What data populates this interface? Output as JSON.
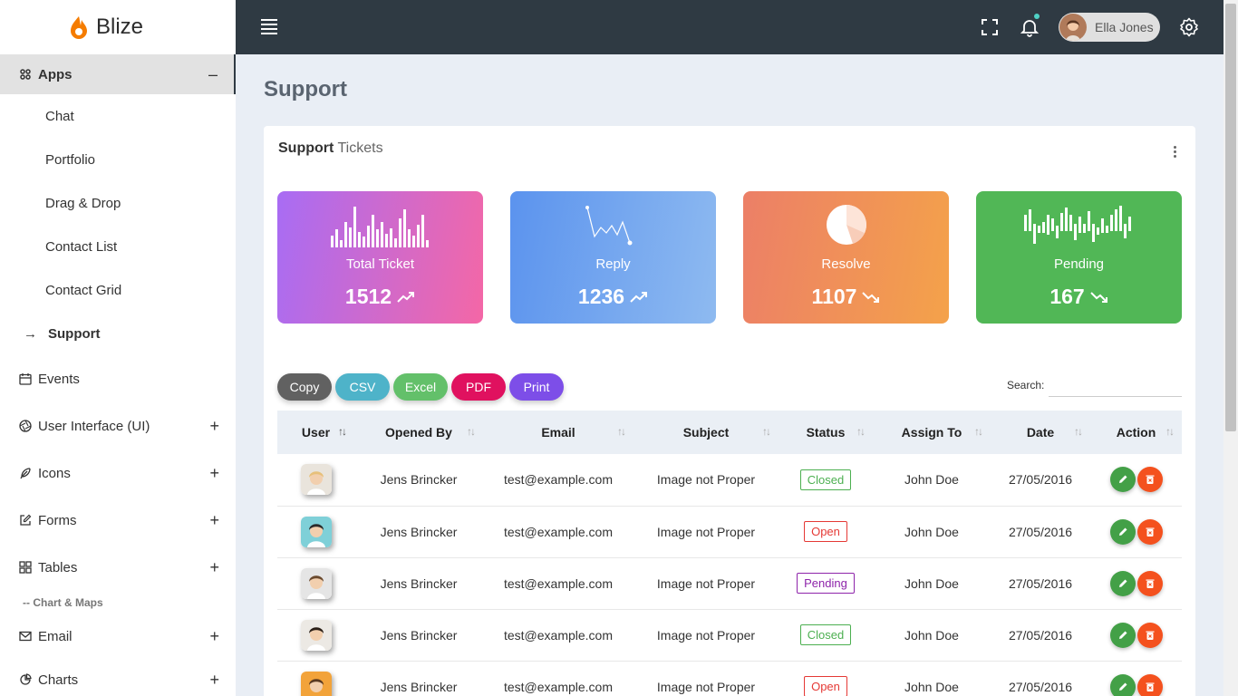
{
  "brand": {
    "name": "Blize"
  },
  "sidebar": {
    "apps": {
      "label": "Apps",
      "toggle": "–"
    },
    "app_items": [
      "Chat",
      "Portfolio",
      "Drag & Drop",
      "Contact List",
      "Contact Grid"
    ],
    "current_item": {
      "arrow": "→",
      "label": "Support"
    },
    "items": [
      {
        "label": "Events",
        "toggle": ""
      },
      {
        "label": "User Interface (UI)",
        "toggle": "+"
      },
      {
        "label": "Icons",
        "toggle": "+"
      },
      {
        "label": "Forms",
        "toggle": "+"
      },
      {
        "label": "Tables",
        "toggle": "+"
      }
    ],
    "section": "-- Chart & Maps",
    "items2": [
      {
        "label": "Email",
        "toggle": "+"
      },
      {
        "label": "Charts",
        "toggle": "+"
      }
    ]
  },
  "topbar": {
    "user_name": "Ella Jones"
  },
  "page": {
    "title": "Support"
  },
  "card": {
    "title_bold": "Support",
    "title_light": " Tickets"
  },
  "stats": [
    {
      "label": "Total Ticket",
      "value": "1512",
      "trend": "up"
    },
    {
      "label": "Reply",
      "value": "1236",
      "trend": "up"
    },
    {
      "label": "Resolve",
      "value": "1107",
      "trend": "down"
    },
    {
      "label": "Pending",
      "value": "167",
      "trend": "down"
    }
  ],
  "export_buttons": [
    {
      "label": "Copy",
      "color": "#616161"
    },
    {
      "label": "CSV",
      "color": "#4eb3c9"
    },
    {
      "label": "Excel",
      "color": "#63c06a"
    },
    {
      "label": "PDF",
      "color": "#e0115f"
    },
    {
      "label": "Print",
      "color": "#7d4ee8"
    }
  ],
  "search": {
    "label": "Search:",
    "value": ""
  },
  "table": {
    "headers": [
      "User",
      "Opened By",
      "Email",
      "Subject",
      "Status",
      "Assign To",
      "Date",
      "Action"
    ],
    "rows": [
      {
        "opened_by": "Jens Brincker",
        "email": "test@example.com",
        "subject": "Image not Proper",
        "status": "Closed",
        "assign_to": "John Doe",
        "date": "27/05/2016"
      },
      {
        "opened_by": "Jens Brincker",
        "email": "test@example.com",
        "subject": "Image not Proper",
        "status": "Open",
        "assign_to": "John Doe",
        "date": "27/05/2016"
      },
      {
        "opened_by": "Jens Brincker",
        "email": "test@example.com",
        "subject": "Image not Proper",
        "status": "Pending",
        "assign_to": "John Doe",
        "date": "27/05/2016"
      },
      {
        "opened_by": "Jens Brincker",
        "email": "test@example.com",
        "subject": "Image not Proper",
        "status": "Closed",
        "assign_to": "John Doe",
        "date": "27/05/2016"
      },
      {
        "opened_by": "Jens Brincker",
        "email": "test@example.com",
        "subject": "Image not Proper",
        "status": "Open",
        "assign_to": "John Doe",
        "date": "27/05/2016"
      }
    ]
  }
}
